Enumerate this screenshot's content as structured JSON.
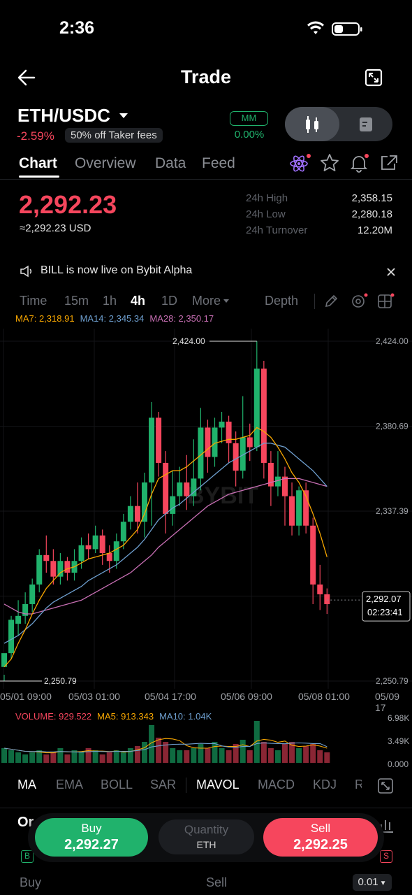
{
  "status": {
    "time": "2:36"
  },
  "header": {
    "title": "Trade",
    "back_icon": "back-arrow-icon",
    "expand_icon": "expand-icon"
  },
  "pair": {
    "name": "ETH/USDC",
    "change": "-2.59%",
    "fee_badge": "50% off Taker fees",
    "mm_label": "MM",
    "mm_value": "0.00%"
  },
  "tabs": [
    "Chart",
    "Overview",
    "Data",
    "Feed"
  ],
  "price": {
    "last": "2,292.23",
    "usd": "≈2,292.23 USD",
    "stats": [
      {
        "label": "24h High",
        "value": "2,358.15"
      },
      {
        "label": "24h Low",
        "value": "2,280.18"
      },
      {
        "label": "24h Turnover",
        "value": "12.20M"
      }
    ]
  },
  "announcement": "BILL is now live on Bybit Alpha",
  "intervals": [
    "Time",
    "15m",
    "1h",
    "4h",
    "1D",
    "More",
    "Depth"
  ],
  "active_interval": "4h",
  "ma_legend": {
    "ma7": "MA7: 2,318.91",
    "ma14": "MA14: 2,345.34",
    "ma28": "MA28: 2,350.17"
  },
  "colors": {
    "ma7": "#f7a600",
    "ma14": "#6e9fcf",
    "ma28": "#c86fb4",
    "up": "#20b26c",
    "down": "#f6465d"
  },
  "chart_data": {
    "type": "candlestick",
    "y_axis_labels": [
      "2,424.00",
      "2,380.69",
      "2,337.39",
      "2,250.79"
    ],
    "ylim": [
      2250.79,
      2424.0
    ],
    "max_marker": "2,424.00",
    "min_marker": "2,250.79",
    "current_price": "2,292.07",
    "countdown": "02:23:41",
    "x_labels": [
      "05/01 09:00",
      "05/03 01:00",
      "05/04 17:00",
      "05/06 09:00",
      "05/08 01:00",
      "05/09 17"
    ],
    "candles": [
      [
        2258,
        2265,
        2254,
        2251
      ],
      [
        2265,
        2282,
        2284,
        2262
      ],
      [
        2280,
        2284,
        2292,
        2274
      ],
      [
        2284,
        2290,
        2296,
        2280
      ],
      [
        2290,
        2300,
        2303,
        2286
      ],
      [
        2300,
        2315,
        2318,
        2296
      ],
      [
        2315,
        2312,
        2325,
        2306
      ],
      [
        2312,
        2304,
        2318,
        2300
      ],
      [
        2304,
        2312,
        2316,
        2300
      ],
      [
        2312,
        2306,
        2314,
        2302
      ],
      [
        2306,
        2312,
        2318,
        2302
      ],
      [
        2312,
        2320,
        2324,
        2308
      ],
      [
        2320,
        2318,
        2326,
        2313
      ],
      [
        2318,
        2325,
        2330,
        2316
      ],
      [
        2325,
        2316,
        2328,
        2310
      ],
      [
        2316,
        2312,
        2320,
        2306
      ],
      [
        2312,
        2322,
        2326,
        2308
      ],
      [
        2322,
        2332,
        2336,
        2318
      ],
      [
        2332,
        2340,
        2345,
        2328
      ],
      [
        2340,
        2332,
        2352,
        2326
      ],
      [
        2332,
        2352,
        2357,
        2324
      ],
      [
        2352,
        2385,
        2393,
        2330
      ],
      [
        2385,
        2362,
        2388,
        2355
      ],
      [
        2362,
        2336,
        2368,
        2326
      ],
      [
        2336,
        2345,
        2358,
        2330
      ],
      [
        2345,
        2352,
        2360,
        2340
      ],
      [
        2352,
        2345,
        2366,
        2338
      ],
      [
        2345,
        2354,
        2374,
        2340
      ],
      [
        2354,
        2380,
        2390,
        2348
      ],
      [
        2380,
        2365,
        2384,
        2357
      ],
      [
        2365,
        2380,
        2385,
        2360
      ],
      [
        2380,
        2383,
        2388,
        2372
      ],
      [
        2383,
        2372,
        2386,
        2362
      ],
      [
        2372,
        2358,
        2378,
        2350
      ],
      [
        2358,
        2375,
        2396,
        2354
      ],
      [
        2375,
        2370,
        2382,
        2363
      ],
      [
        2370,
        2410,
        2424,
        2368
      ],
      [
        2410,
        2362,
        2414,
        2354
      ],
      [
        2362,
        2350,
        2368,
        2340
      ],
      [
        2350,
        2355,
        2368,
        2345
      ],
      [
        2355,
        2345,
        2360,
        2330
      ],
      [
        2345,
        2330,
        2352,
        2325
      ],
      [
        2330,
        2348,
        2350,
        2325
      ],
      [
        2348,
        2330,
        2352,
        2326
      ],
      [
        2330,
        2300,
        2334,
        2290
      ],
      [
        2300,
        2295,
        2310,
        2287
      ],
      [
        2295,
        2290,
        2298,
        2285
      ]
    ],
    "ma7": [
      2258,
      2262,
      2270,
      2277,
      2285,
      2292,
      2298,
      2302,
      2306,
      2308,
      2309,
      2311,
      2313,
      2314,
      2315,
      2316,
      2318,
      2320,
      2324,
      2328,
      2336,
      2346,
      2354,
      2356,
      2358,
      2358,
      2360,
      2363,
      2366,
      2369,
      2372,
      2373,
      2374,
      2374,
      2375,
      2376,
      2380,
      2378,
      2375,
      2370,
      2364,
      2357,
      2352,
      2345,
      2336,
      2326,
      2314
    ],
    "ma14": [
      2270,
      2272,
      2274,
      2277,
      2280,
      2284,
      2288,
      2291,
      2293,
      2295,
      2297,
      2299,
      2302,
      2304,
      2306,
      2308,
      2310,
      2313,
      2316,
      2319,
      2323,
      2328,
      2333,
      2336,
      2339,
      2341,
      2344,
      2347,
      2350,
      2353,
      2356,
      2359,
      2362,
      2364,
      2366,
      2368,
      2370,
      2372,
      2372,
      2371,
      2370,
      2367,
      2364,
      2361,
      2358,
      2354,
      2350
    ],
    "ma28": [
      2290,
      2288,
      2286,
      2285,
      2285,
      2286,
      2287,
      2288,
      2289,
      2290,
      2291,
      2292,
      2294,
      2296,
      2298,
      2300,
      2302,
      2304,
      2306,
      2309,
      2312,
      2315,
      2319,
      2322,
      2325,
      2328,
      2331,
      2334,
      2337,
      2340,
      2342,
      2344,
      2346,
      2347,
      2348,
      2349,
      2350,
      2351,
      2352,
      2353,
      2354,
      2354,
      2354,
      2353,
      2352,
      2351,
      2350
    ]
  },
  "volume": {
    "legend": {
      "vol": "VOLUME: 929.522",
      "ma5": "MA5: 913.343",
      "ma10": "MA10: 1.04K"
    },
    "axis": [
      "6.98K",
      "3.49K",
      "0.000"
    ],
    "values": [
      0.35,
      0.3,
      0.25,
      0.2,
      0.25,
      0.3,
      0.2,
      0.25,
      0.35,
      0.2,
      0.3,
      0.25,
      0.35,
      0.3,
      0.2,
      0.25,
      0.3,
      0.25,
      0.35,
      0.4,
      0.5,
      0.9,
      0.6,
      0.5,
      0.35,
      0.3,
      0.3,
      0.35,
      0.45,
      0.35,
      0.5,
      0.35,
      0.3,
      0.45,
      0.55,
      0.3,
      1.0,
      0.5,
      0.35,
      0.3,
      0.45,
      0.5,
      0.35,
      0.4,
      0.45,
      0.3,
      0.25
    ]
  },
  "indicators": [
    "MA",
    "EMA",
    "BOLL",
    "SAR",
    "MAVOL",
    "MACD",
    "KDJ",
    "R"
  ],
  "order": {
    "buy_label": "Buy",
    "buy_price": "2,292.27",
    "qty_label": "Quantity",
    "qty_unit": "ETH",
    "sell_label": "Sell",
    "sell_price": "2,292.25",
    "bottom_buy": "Buy",
    "bottom_sell": "Sell",
    "tick": "0.01",
    "under_label": "Or"
  }
}
